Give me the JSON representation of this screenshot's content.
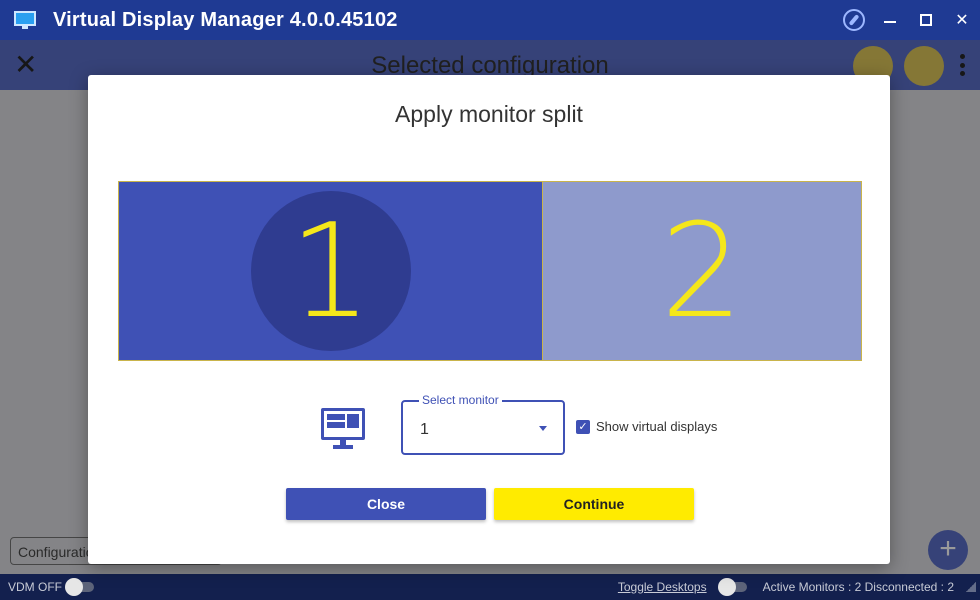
{
  "window": {
    "title": "Virtual Display Manager 4.0.0.45102",
    "icons": [
      "monitor-icon",
      "compass-icon",
      "minimize-icon",
      "maximize-icon",
      "close-icon"
    ],
    "controls": {
      "minimize": "–",
      "maximize": "",
      "close": "✕"
    }
  },
  "header": {
    "title": "Selected configuration",
    "close_glyph": "✕"
  },
  "footer": {
    "config_tab": "Configuration",
    "add_glyph": "+"
  },
  "statusbar": {
    "vdm_label": "VDM OFF",
    "toggle_desktops": "Toggle Desktops",
    "active_monitors": "Active Monitors : 2 Disconnected : 2"
  },
  "dialog": {
    "title": "Apply monitor split",
    "monitors": [
      {
        "label": "1",
        "selected": true
      },
      {
        "label": "2",
        "selected": false
      }
    ],
    "select": {
      "legend": "Select monitor",
      "value": "1"
    },
    "checkbox": {
      "label": "Show virtual displays",
      "checked": true,
      "check_glyph": "✓"
    },
    "buttons": {
      "close": "Close",
      "continue": "Continue"
    }
  },
  "colors": {
    "titlebar": "#1f3a93",
    "accent": "#3f51b5",
    "monitor_selected": "#3f51b5",
    "monitor_unselected": "#8e9acc",
    "digit": "#f5e71a",
    "continue_button": "#ffeb00",
    "statusbar": "#13204e"
  }
}
